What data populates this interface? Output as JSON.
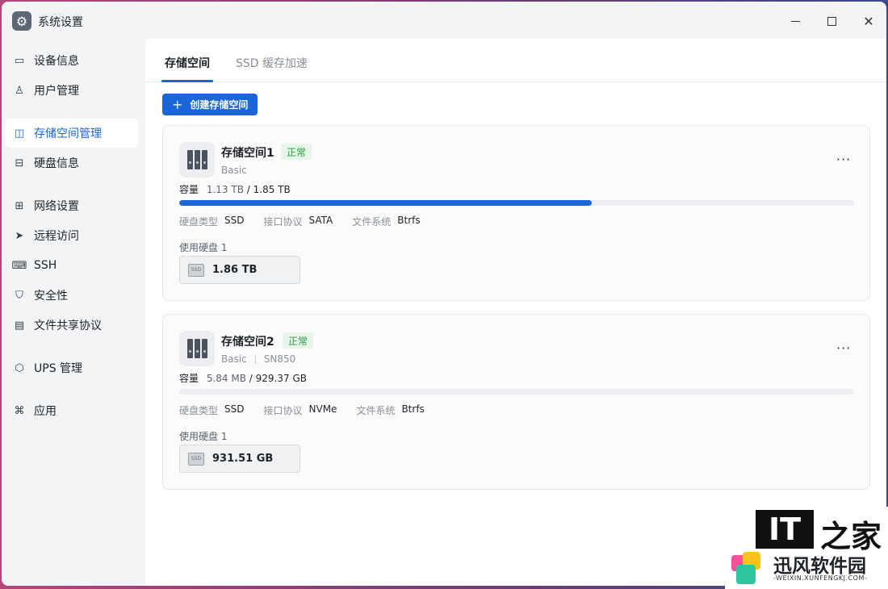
{
  "window": {
    "title": "系统设置",
    "minimize_icon": "minimize-icon",
    "maximize_icon": "maximize-icon",
    "close_label": "✕"
  },
  "sidebar": {
    "items": [
      {
        "label": "设备信息",
        "icon": "device-icon"
      },
      {
        "label": "用户管理",
        "icon": "user-icon"
      },
      {
        "label": "存储空间管理",
        "icon": "storage-icon",
        "active": true
      },
      {
        "label": "硬盘信息",
        "icon": "disk-icon"
      },
      {
        "label": "网络设置",
        "icon": "network-icon"
      },
      {
        "label": "远程访问",
        "icon": "remote-icon"
      },
      {
        "label": "SSH",
        "icon": "terminal-icon"
      },
      {
        "label": "安全性",
        "icon": "shield-icon"
      },
      {
        "label": "文件共享协议",
        "icon": "file-icon"
      },
      {
        "label": "UPS 管理",
        "icon": "ups-icon"
      },
      {
        "label": "应用",
        "icon": "apps-icon"
      }
    ]
  },
  "main": {
    "tabs": [
      {
        "label": "存储空间",
        "active": true
      },
      {
        "label": "SSD 缓存加速",
        "active": false
      }
    ],
    "create_button": {
      "icon": "+",
      "label": "创建存储空间"
    }
  },
  "pools": [
    {
      "name": "存储空间1",
      "status": "正常",
      "raid": "Basic",
      "model": "",
      "capacity_label": "容量",
      "used": "1.13 TB",
      "total": "/ 1.85 TB",
      "usage_fraction": 0.611,
      "disk_type_label": "硬盘类型",
      "disk_type": "SSD",
      "interface_label": "接口协议",
      "interface": "SATA",
      "fs_label": "文件系统",
      "fs": "Btrfs",
      "disks_used_label": "使用硬盘 1",
      "disk_size": "1.86 TB"
    },
    {
      "name": "存储空间2",
      "status": "正常",
      "raid": "Basic",
      "model": "SN850",
      "capacity_label": "容量",
      "used": "5.84 MB",
      "total": "/ 929.37 GB",
      "usage_fraction": 0.0,
      "disk_type_label": "硬盘类型",
      "disk_type": "SSD",
      "interface_label": "接口协议",
      "interface": "NVMe",
      "fs_label": "文件系统",
      "fs": "Btrfs",
      "disks_used_label": "使用硬盘 1",
      "disk_size": "931.51 GB"
    }
  ],
  "watermark": {
    "it": "IT",
    "zhijia": "之家",
    "name": "迅风软件园",
    "url": "-WEIXIN.XUNFENGKJ.COM-"
  },
  "colors": {
    "accent": "#1a66d8",
    "status_ok_bg": "#e7f6e9",
    "status_ok_text": "#2e9a47"
  }
}
